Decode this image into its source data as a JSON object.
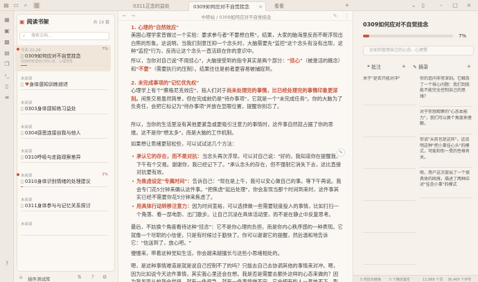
{
  "tabbar": {
    "tabs": [
      {
        "label": "0311正念的益处",
        "active": false
      },
      {
        "label": "0309如何应对不自觉挂念",
        "active": true
      },
      {
        "label": "看看",
        "active": false
      }
    ]
  },
  "sidebar": {
    "title": "阅读书架",
    "count": "共 19 篇",
    "search_placeholder": "搜索文档...",
    "items": [
      {
        "meta": "今天 21:28",
        "pct": "7%",
        "title": "0309如何应对不自觉挂念",
        "sub": "论如何管理自己的心念、心理惯性",
        "progress": 0.07,
        "selected": true,
        "dot": true
      },
      {
        "meta": "未阅读",
        "pct": "",
        "title": "身体感知训练综述",
        "sub": "",
        "progress": 0,
        "heart": true
      },
      {
        "meta": "未阅读",
        "pct": "",
        "title": "0303身体感知练习益处",
        "sub": "",
        "progress": 0
      },
      {
        "meta": "未阅读",
        "pct": "",
        "title": "0304感恩连接自我与他人",
        "sub": "",
        "progress": 0
      },
      {
        "meta": "未阅读",
        "pct": "",
        "title": "0310呼吸与走路观察差异",
        "sub": "",
        "progress": 0
      },
      {
        "meta": "未阅读",
        "pct": "2%",
        "title": "0310身体识别情绪的处理建议",
        "sub": "",
        "progress": 0.02,
        "dot": true
      },
      {
        "meta": "未阅读",
        "pct": "",
        "title": "0311身体参与与记忆关系探讨",
        "sub": "",
        "progress": 0
      },
      {
        "meta": "未阅读",
        "pct": "",
        "title": "",
        "sub": "",
        "progress": 0
      }
    ],
    "footer_label": "插件测试库"
  },
  "editor": {
    "breadcrumb": "中转站 / 0309如何应对不自觉挂念",
    "h1": "1. 心理的\"自然效应\"",
    "p1": "美国心理学家曾做过一个实验：要求参与者\"不要想白熊\"。结果，大家的脑海里反而不断浮现出白熊的形象。这说明，当我们刻意压抑一个念头时，大脑需要先\"监控\"这个念头有没有出现，这种\"监控\"行为，反而让这个念头一直活跃在你的意识中。",
    "p2_a": "所以，当你对自己说\"不用挂心\"，大脑接受到的指令其实是两个部分：",
    "p2_b": "\"挂心\"",
    "p2_c": "（被激活的概念）和",
    "p2_d": "\"不要\"",
    "p2_e": "（需要执行的压制）。结果往往是前者更容易被捕捉到。",
    "h2": "2. 未完成事项的\"记忆优先权\"",
    "p3_a": "心理学上有个\"蔡格尼克效应\"，指人们对于",
    "p3_b": "尚未处理完的事情，比已经处理完的事情印象更深刻。",
    "p3_c": "闲鱼交易虽然简单，但在完成前仍是\"待办事项\"，它就是一个\"未完成任务\"。你的大脑为了负责任，会把它标记为\"待办事项\"并放在显眼位置，提醒你别忘了。",
    "p4": "所以，当你的生活里没有其他更紧急或更吸引注意力的事情时，这件事自然就占据了你的思维。这不是你\"想太多\"，而是大脑的工作机制。",
    "p5": "如果想让思绪更轻松些，可以试试这几个方法：",
    "b1_a": "承认它的存在，而不是对抗：",
    "b1_b": "当念头再次浮现，可以对自己说：\"好的，我知道你在提醒我，下午有个交易。谢谢你，我已经记下了。\"承认念头的存在，但不强制它消失下去，这比直接对抗要有效。",
    "b2_a": "为焦虑设定\"专属时间\"：",
    "b2_b": "告诉自己：\"现在是上午，我可以安心做自己的事。等下午再说。我会专门花5分钟来确认这件事。\"把焦虑\"延后处理\"，你会发现当那个时间到来时，这件事其实已经不需要你花5分钟来焦虑了。",
    "b3_a": "用具体行动转移注意力：",
    "b3_b": "因为时间宽裕，可以选择做一些需要轻度投入的事情，比如打扫一个角落、看一部电影、出门散步。让自己沉浸在具体活动里，而不是在静止中反复思考。",
    "p6": "最后，不妨换个角度看待这种\"挂念\"：它不是你心理的负担，而是你内心秩序感的一种表现。它就像一个尽职的小信使，只是有时候过于勤快了。你可以谢谢它的提醒，然后温和地告诉它：\"信送到了，放心吧。\"",
    "p7": "慢慢来，带着这种觉知生活，你会越来越擅长与这些小思绪相处的。",
    "p8": "嗯，是这种事情难道是就是说自己控制不了的吗？只能去自己去协调其他的事情来对冲。嗯，因为比如说今天这件事情，其实我心里还会在想。我是否是需要去额外这样的心态来做的？因为我发现从前我会觉得，就有一件很急，就有一件事情做不完，它会把有些人一直放不下，影响到我后面的事情做。而且我以前的时候就会，那是一件事情，我以前好几个事情就会，所以的话，所以我自己想是，我不知道是我一直在想心里是否是我自己在想这样的心想。"
  },
  "right": {
    "title": "0309如何应对不自觉挂念",
    "pct": "7%",
    "progress": 0.07,
    "note_placeholder": "论如何管理自己的心念、心理惯",
    "tab_note": "批注",
    "tab_excerpt": "摘录",
    "left_cards": [
      "关于\"是否只能对冲\"",
      "",
      "",
      "",
      "",
      ""
    ],
    "right_cards": [
      "你的追问非常深刻。它触及了一个核心问题：我们到底能不能完全控制自己的思绪？",
      "对于你想观察的\"心态本能力\"，我们可以换个角度来理解。",
      "你说\"从前也是这样\"，这说明这种\"把小事挂心头\"的模式，可能和你一贯的性格有关。",
      "嗯，用户这次提出了一个很具体的困境，描述了两种应对\"挂念小事\"的模式"
    ],
    "status_items": [
      "5 项反向链接",
      "5 个确定属性",
      "12,989 个词",
      "36,469 个字符"
    ]
  }
}
